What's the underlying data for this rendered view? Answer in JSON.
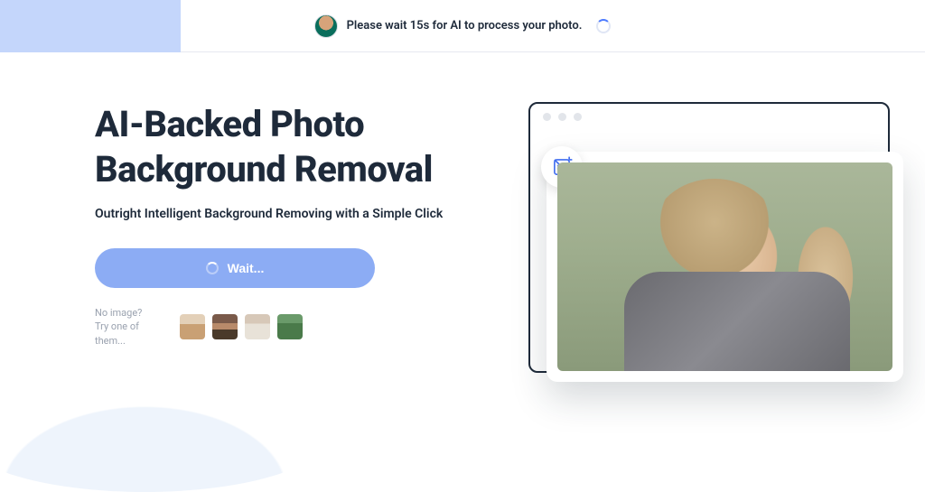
{
  "notification": {
    "message": "Please wait 15s for AI to process your photo."
  },
  "hero": {
    "title": "AI-Backed Photo Background Removal",
    "subtitle": "Outright Intelligent Background Removing with a Simple Click"
  },
  "button": {
    "label": "Wait..."
  },
  "samples": {
    "line1": "No image?",
    "line2": "Try one of them..."
  },
  "badge": {
    "name": "fx-crop-icon"
  }
}
